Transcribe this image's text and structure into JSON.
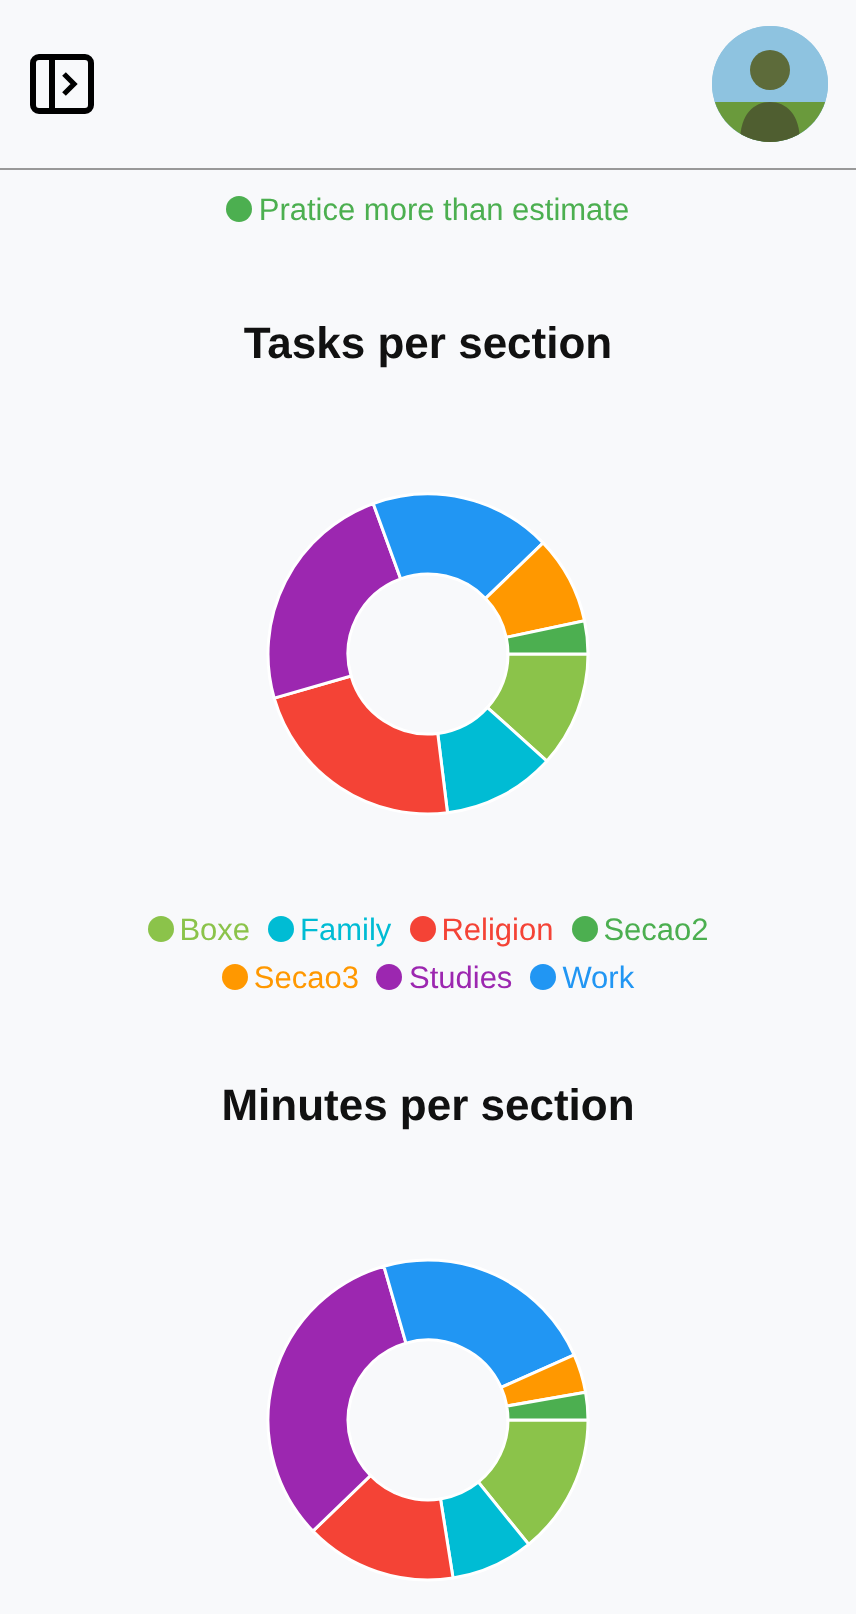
{
  "estimate_legend": [
    {
      "label": "Pratice more than estimate",
      "color": "#4caf50"
    }
  ],
  "charts": [
    {
      "title": "Tasks per section",
      "legend": [
        {
          "label": "Boxe",
          "color": "#8bc34a"
        },
        {
          "label": "Family",
          "color": "#00bcd4"
        },
        {
          "label": "Religion",
          "color": "#f44336"
        },
        {
          "label": "Secao2",
          "color": "#4caf50"
        },
        {
          "label": "Secao3",
          "color": "#ff9800"
        },
        {
          "label": "Studies",
          "color": "#9c27b0"
        },
        {
          "label": "Work",
          "color": "#2196f3"
        }
      ]
    },
    {
      "title": "Minutes per section"
    }
  ]
}
